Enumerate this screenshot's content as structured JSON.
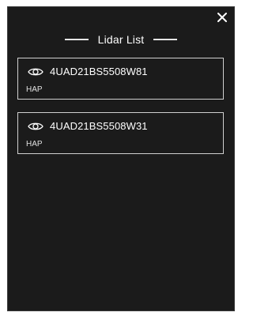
{
  "dialog": {
    "title": "Lidar List",
    "close_icon": "close-icon"
  },
  "lidars": [
    {
      "serial": "4UAD21BS5508W81",
      "type": "HAP",
      "visibility_icon": "eye-icon"
    },
    {
      "serial": "4UAD21BS5508W31",
      "type": "HAP",
      "visibility_icon": "eye-icon"
    }
  ],
  "colors": {
    "panel_background": "#1b1b1b",
    "card_border": "#d0d0d0",
    "text": "#ffffff"
  }
}
